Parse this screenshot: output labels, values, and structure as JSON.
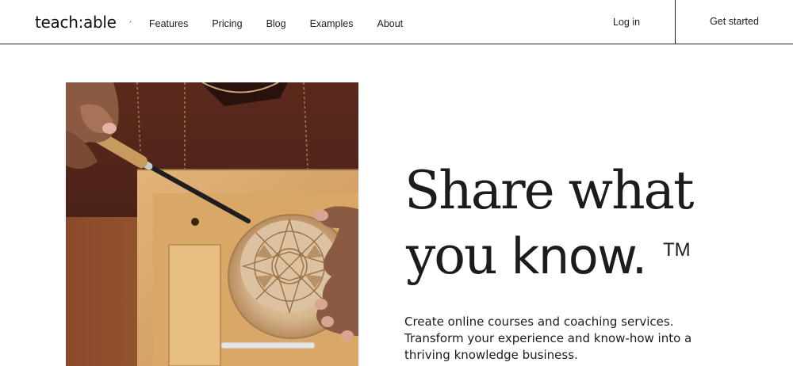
{
  "brand": {
    "logo_text": "teach:able",
    "dot": "·"
  },
  "nav": {
    "items": [
      "Features",
      "Pricing",
      "Blog",
      "Examples",
      "About"
    ],
    "login_label": "Log in",
    "cta_label": "Get started"
  },
  "hero": {
    "headline_line1": "Share what",
    "headline_line2_serif": "you ",
    "headline_line2_sans": "know.",
    "trademark": "TM",
    "subtext_lines": [
      "Create online courses and coaching services.",
      "Transform your experience and know-how into a",
      "thriving knowledge business."
    ],
    "image_subject": "hands-carving-wooden-bowl"
  }
}
